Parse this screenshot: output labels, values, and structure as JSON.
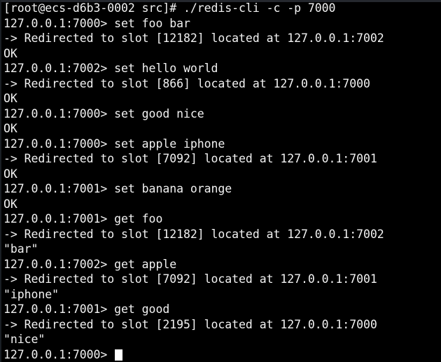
{
  "terminal": {
    "app": "redis-cli",
    "colors": {
      "background": "#000000",
      "foreground": "#f2f2f2",
      "cursor": "#ffffff",
      "top_strip": "#2b2f36",
      "left_strip": "#1d2128"
    },
    "shell_prompt": "[root@ecs-d6b3-0002 src]#",
    "command": "./redis-cli -c -p 7000",
    "cursor": {
      "visible": true,
      "style": "block",
      "line_index": 23
    },
    "lines": [
      "[root@ecs-d6b3-0002 src]# ./redis-cli -c -p 7000",
      "127.0.0.1:7000> set foo bar",
      "-> Redirected to slot [12182] located at 127.0.0.1:7002",
      "OK",
      "127.0.0.1:7002> set hello world",
      "-> Redirected to slot [866] located at 127.0.0.1:7000",
      "OK",
      "127.0.0.1:7000> set good nice",
      "OK",
      "127.0.0.1:7000> set apple iphone",
      "-> Redirected to slot [7092] located at 127.0.0.1:7001",
      "OK",
      "127.0.0.1:7001> set banana orange",
      "OK",
      "127.0.0.1:7001> get foo",
      "-> Redirected to slot [12182] located at 127.0.0.1:7002",
      "\"bar\"",
      "127.0.0.1:7002> get apple",
      "-> Redirected to slot [7092] located at 127.0.0.1:7001",
      "\"iphone\"",
      "127.0.0.1:7001> get good",
      "-> Redirected to slot [2195] located at 127.0.0.1:7000",
      "\"nice\"",
      "127.0.0.1:7000> "
    ]
  }
}
